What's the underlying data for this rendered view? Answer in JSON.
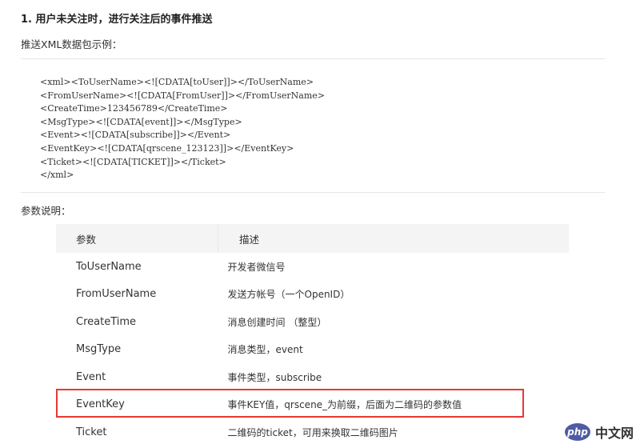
{
  "section": {
    "heading": "1. 用户未关注时，进行关注后的事件推送",
    "subtitle": "推送XML数据包示例："
  },
  "code_lines": [
    "<xml><ToUserName><![CDATA[toUser]]></ToUserName>",
    "<FromUserName><![CDATA[FromUser]]></FromUserName>",
    "<CreateTime>123456789</CreateTime>",
    "<MsgType><![CDATA[event]]></MsgType>",
    "<Event><![CDATA[subscribe]]></Event>",
    "<EventKey><![CDATA[qrscene_123123]]></EventKey>",
    "<Ticket><![CDATA[TICKET]]></Ticket>",
    "</xml>"
  ],
  "params": {
    "label": "参数说明：",
    "headers": [
      "参数",
      "描述"
    ],
    "rows": [
      {
        "name": "ToUserName",
        "desc": "开发者微信号"
      },
      {
        "name": "FromUserName",
        "desc": "发送方帐号（一个OpenID）"
      },
      {
        "name": "CreateTime",
        "desc": "消息创建时间 （整型）"
      },
      {
        "name": "MsgType",
        "desc": "消息类型，event"
      },
      {
        "name": "Event",
        "desc": "事件类型，subscribe"
      },
      {
        "name": "EventKey",
        "desc": "事件KEY值，qrscene_为前缀，后面为二维码的参数值"
      },
      {
        "name": "Ticket",
        "desc": "二维码的ticket，可用来换取二维码图片"
      }
    ],
    "highlight_color": "#e53935"
  },
  "watermark": {
    "logo": "php",
    "text": "中文网"
  }
}
